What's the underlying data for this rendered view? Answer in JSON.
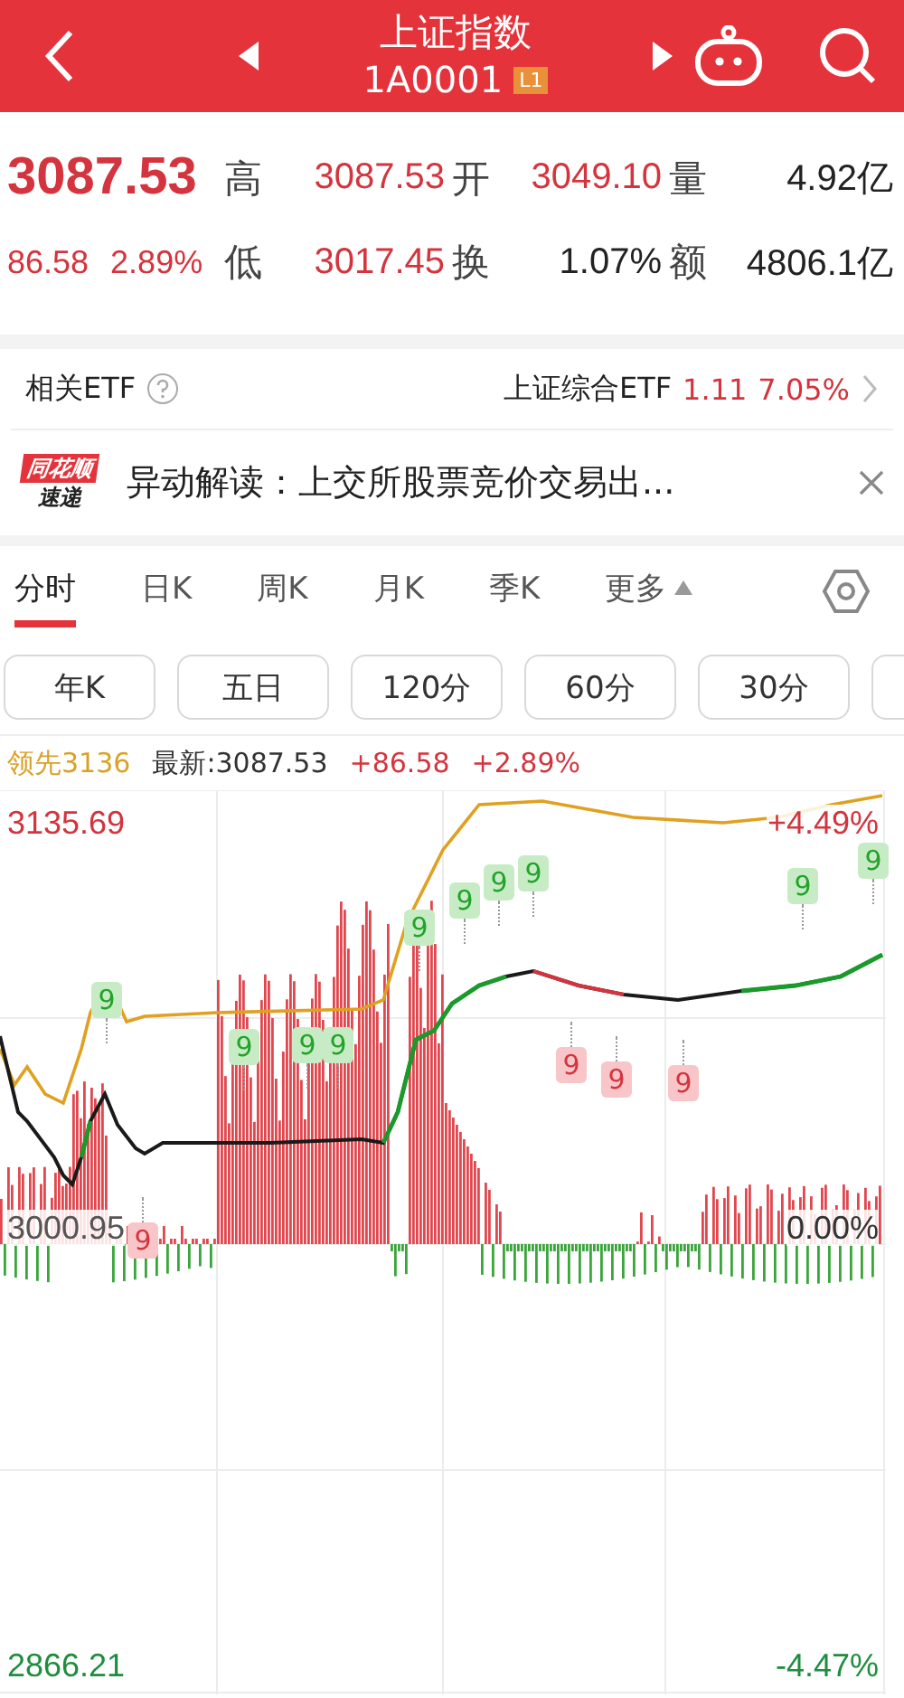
{
  "header": {
    "title": "上证指数",
    "code": "1A0001",
    "level_badge": "L1"
  },
  "quote": {
    "price": "3087.53",
    "change": "86.58",
    "change_pct": "2.89%",
    "stats": [
      {
        "label": "高",
        "value": "3087.53",
        "color": "#d4343d"
      },
      {
        "label": "开",
        "value": "3049.10",
        "color": "#d4343d"
      },
      {
        "label": "量",
        "value": "4.92亿",
        "color": "#222222"
      },
      {
        "label": "低",
        "value": "3017.45",
        "color": "#d4343d"
      },
      {
        "label": "换",
        "value": "1.07%",
        "color": "#222222"
      },
      {
        "label": "额",
        "value": "4806.1亿",
        "color": "#222222"
      }
    ]
  },
  "etf": {
    "label": "相关ETF",
    "name": "上证综合ETF",
    "price": "1.11",
    "change_pct": "7.05%"
  },
  "news": {
    "badge_top": "同花顺",
    "badge_bottom": "速递",
    "text": "异动解读：上交所股票竞价交易出..."
  },
  "tabs": [
    {
      "label": "分时",
      "selected": true
    },
    {
      "label": "日K",
      "selected": false
    },
    {
      "label": "周K",
      "selected": false
    },
    {
      "label": "月K",
      "selected": false
    },
    {
      "label": "季K",
      "selected": false
    },
    {
      "label": "更多",
      "selected": false
    }
  ],
  "period_buttons": [
    "年K",
    "五日",
    "120分",
    "60分",
    "30分"
  ],
  "chart": {
    "leader": "领先3136",
    "latest": "最新:3087.53",
    "change": "+86.58",
    "change_pct": "+2.89%",
    "top_price": "3135.69",
    "top_pct": "+4.49%",
    "mid_price": "3000.95",
    "mid_pct": "0.00%",
    "bottom_price": "2866.21",
    "bottom_pct": "-4.47%",
    "markers": [
      {
        "kind": "up",
        "label": "9"
      },
      {
        "kind": "down",
        "label": "9"
      },
      {
        "kind": "up",
        "label": "9"
      },
      {
        "kind": "up",
        "label": "9"
      },
      {
        "kind": "up",
        "label": "9"
      },
      {
        "kind": "up",
        "label": "9"
      },
      {
        "kind": "up",
        "label": "9"
      },
      {
        "kind": "up",
        "label": "9"
      },
      {
        "kind": "up",
        "label": "9"
      },
      {
        "kind": "down",
        "label": "9"
      },
      {
        "kind": "down",
        "label": "9"
      },
      {
        "kind": "down",
        "label": "9"
      },
      {
        "kind": "up",
        "label": "9"
      },
      {
        "kind": "up",
        "label": "9"
      }
    ]
  }
}
